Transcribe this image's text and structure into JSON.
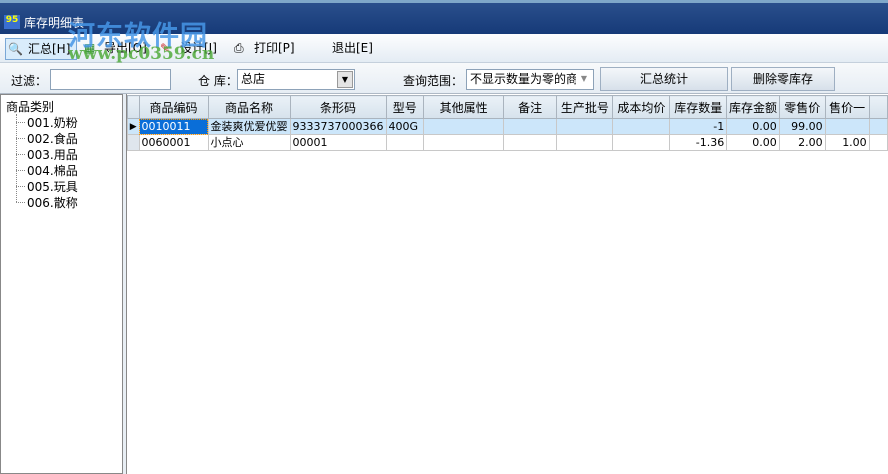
{
  "window": {
    "title": "库存明细表"
  },
  "watermark": {
    "name": "河东软件园",
    "url": "www.pc0359.cn"
  },
  "toolbar": {
    "summary": "汇总[H]",
    "export": "导出[O]",
    "design": "设计[J]",
    "print": "打印[P]",
    "exit": "退出[E]"
  },
  "filter": {
    "filter_label": "过滤：",
    "filter_value": "",
    "warehouse_label": "仓 库：",
    "warehouse_value": "总店",
    "range_label": "查询范围：",
    "range_value": "不显示数量为零的商",
    "stat_button": "汇总统计",
    "delete_button": "删除零库存"
  },
  "tree": {
    "root": "商品类别",
    "items": [
      "001.奶粉",
      "002.食品",
      "003.用品",
      "004.棉品",
      "005.玩具",
      "006.散称"
    ]
  },
  "grid": {
    "columns": [
      "商品编码",
      "商品名称",
      "条形码",
      "型号",
      "其他属性",
      "备注",
      "生产批号",
      "成本均价",
      "库存数量",
      "库存金额",
      "零售价",
      "售价一"
    ],
    "rows": [
      [
        "0010011",
        "金装爽优爱优婴",
        "9333737000366",
        "400G",
        "",
        "",
        "",
        "",
        "-1",
        "0.00",
        "99.00",
        ""
      ],
      [
        "0060001",
        "小点心",
        "00001",
        "",
        "",
        "",
        "",
        "",
        "-1.36",
        "0.00",
        "2.00",
        "1.00"
      ]
    ]
  }
}
